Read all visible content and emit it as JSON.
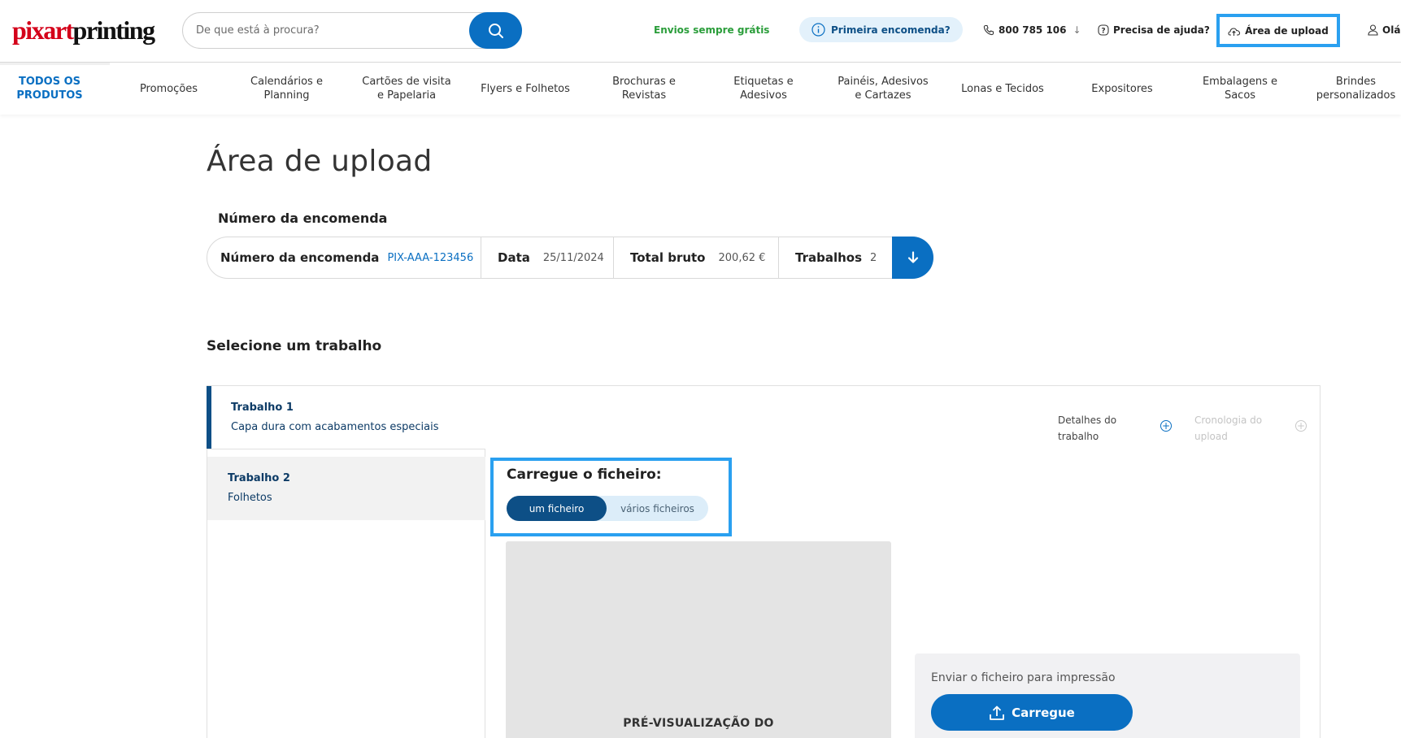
{
  "header": {
    "logo_red": "pixart",
    "logo_black": "printing",
    "search_placeholder": "De que está à procura?",
    "free_shipping": "Envios sempre grátis",
    "first_order": "Primeira encomenda?",
    "phone": "800 785 106",
    "phone_arrow": "↓",
    "help": "Precisa de ajuda?",
    "upload_area": "Área de upload",
    "user": "Olá",
    "colors": {
      "accent": "#0a6fc2",
      "free_shipping": "#2a9d3a",
      "highlight": "#2aa0f0"
    }
  },
  "nav": {
    "items": [
      "TODOS OS PRODUTOS",
      "Promoções",
      "Calendários e Planning",
      "Cartões de visita e Papelaria",
      "Flyers e Folhetos",
      "Brochuras e Revistas",
      "Etiquetas e Adesivos",
      "Painéis, Adesivos e Cartazes",
      "Lonas e Tecidos",
      "Expositores",
      "Embalagens e Sacos",
      "Brindes personalizados"
    ]
  },
  "main": {
    "title": "Área de upload",
    "order_heading": "Número da encomenda",
    "order": {
      "number_label": "Número da encomenda",
      "number_value": "PIX-AAA-123456",
      "date_label": "Data",
      "date_value": "25/11/2024",
      "total_label": "Total bruto",
      "total_value": "200,62 €",
      "jobs_label": "Trabalhos",
      "jobs_value": "2"
    },
    "select_job": "Selecione um trabalho",
    "jobs": [
      {
        "title": "Trabalho 1",
        "subtitle": "Capa dura com acabamentos especiais",
        "active": true
      },
      {
        "title": "Trabalho 2",
        "subtitle": "Folhetos",
        "active": false
      }
    ],
    "job_details": "Detalhes do trabalho",
    "upload_history": "Cronologia do upload",
    "upload_title": "Carregue o ficheiro:",
    "toggle": {
      "single": "um ficheiro",
      "multiple": "vários ficheiros",
      "selected": "single"
    },
    "preview_caption": "PRÉ-VISUALIZAÇÃO DO",
    "send_label": "Enviar o ficheiro para impressão",
    "upload_button": "Carregue"
  }
}
